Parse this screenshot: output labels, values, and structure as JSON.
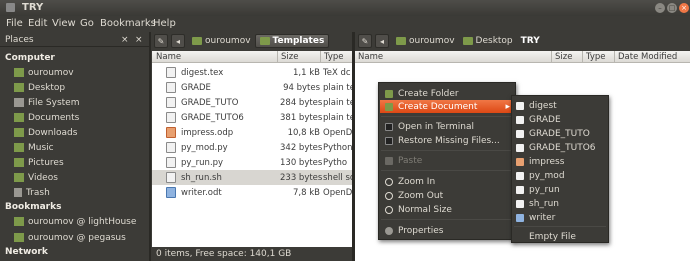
{
  "window": {
    "title": "TRY"
  },
  "menubar": [
    "File",
    "Edit",
    "View",
    "Go",
    "Bookmarks",
    "Help"
  ],
  "sidebar": {
    "header": "Places",
    "sections": [
      {
        "title": "Computer",
        "items": [
          "ouroumov",
          "Desktop",
          "File System",
          "Documents",
          "Downloads",
          "Music",
          "Pictures",
          "Videos",
          "Trash"
        ]
      },
      {
        "title": "Bookmarks",
        "items": [
          "ouroumov @ lightHouse",
          "ouroumov @ pegasus"
        ]
      },
      {
        "title": "Network",
        "items": []
      }
    ]
  },
  "left_pane": {
    "breadcrumbs": [
      "ouroumov",
      "Templates"
    ],
    "columns": [
      "Name",
      "Size",
      "Type"
    ],
    "files": [
      {
        "name": "digest.tex",
        "size": "1,1 kB",
        "type": "TeX dc"
      },
      {
        "name": "GRADE",
        "size": "94 bytes",
        "type": "plain te"
      },
      {
        "name": "GRADE_TUTO",
        "size": "284 bytes",
        "type": "plain te"
      },
      {
        "name": "GRADE_TUTO6",
        "size": "381 bytes",
        "type": "plain te"
      },
      {
        "name": "impress.odp",
        "size": "10,8 kB",
        "type": "OpenD"
      },
      {
        "name": "py_mod.py",
        "size": "342 bytes",
        "type": "Python"
      },
      {
        "name": "py_run.py",
        "size": "130 bytes",
        "type": "Pytho"
      },
      {
        "name": "sh_run.sh",
        "size": "233 bytes",
        "type": "shell sc"
      },
      {
        "name": "writer.odt",
        "size": "7,8 kB",
        "type": "OpenD"
      }
    ],
    "status": "0 items, Free space: 140,1 GB"
  },
  "right_pane": {
    "breadcrumbs": [
      "ouroumov",
      "Desktop",
      "TRY"
    ],
    "columns": [
      "Name",
      "Size",
      "Type",
      "Date Modified"
    ]
  },
  "context_menu": {
    "items": [
      {
        "label": "Create Folder",
        "icon": "folder-icon"
      },
      {
        "label": "Create Document",
        "icon": "document-icon",
        "arrow": "▸"
      },
      {
        "label": "Open in Terminal",
        "icon": "terminal-icon"
      },
      {
        "label": "Restore Missing Files...",
        "icon": "restore-icon"
      },
      {
        "label": "Paste",
        "icon": "paste-icon"
      },
      {
        "label": "Zoom In",
        "icon": "zoom-in-icon"
      },
      {
        "label": "Zoom Out",
        "icon": "zoom-out-icon"
      },
      {
        "label": "Normal Size",
        "icon": "normal-size-icon"
      },
      {
        "label": "Properties",
        "icon": "properties-icon"
      }
    ]
  },
  "submenu": {
    "items": [
      "digest",
      "GRADE",
      "GRADE_TUTO",
      "GRADE_TUTO6",
      "impress",
      "py_mod",
      "py_run",
      "sh_run",
      "writer"
    ],
    "empty_file": "Empty File"
  },
  "colors": {
    "accent": "#dd4814",
    "dark": "#3c3b37",
    "folder": "#7e9a4a"
  }
}
